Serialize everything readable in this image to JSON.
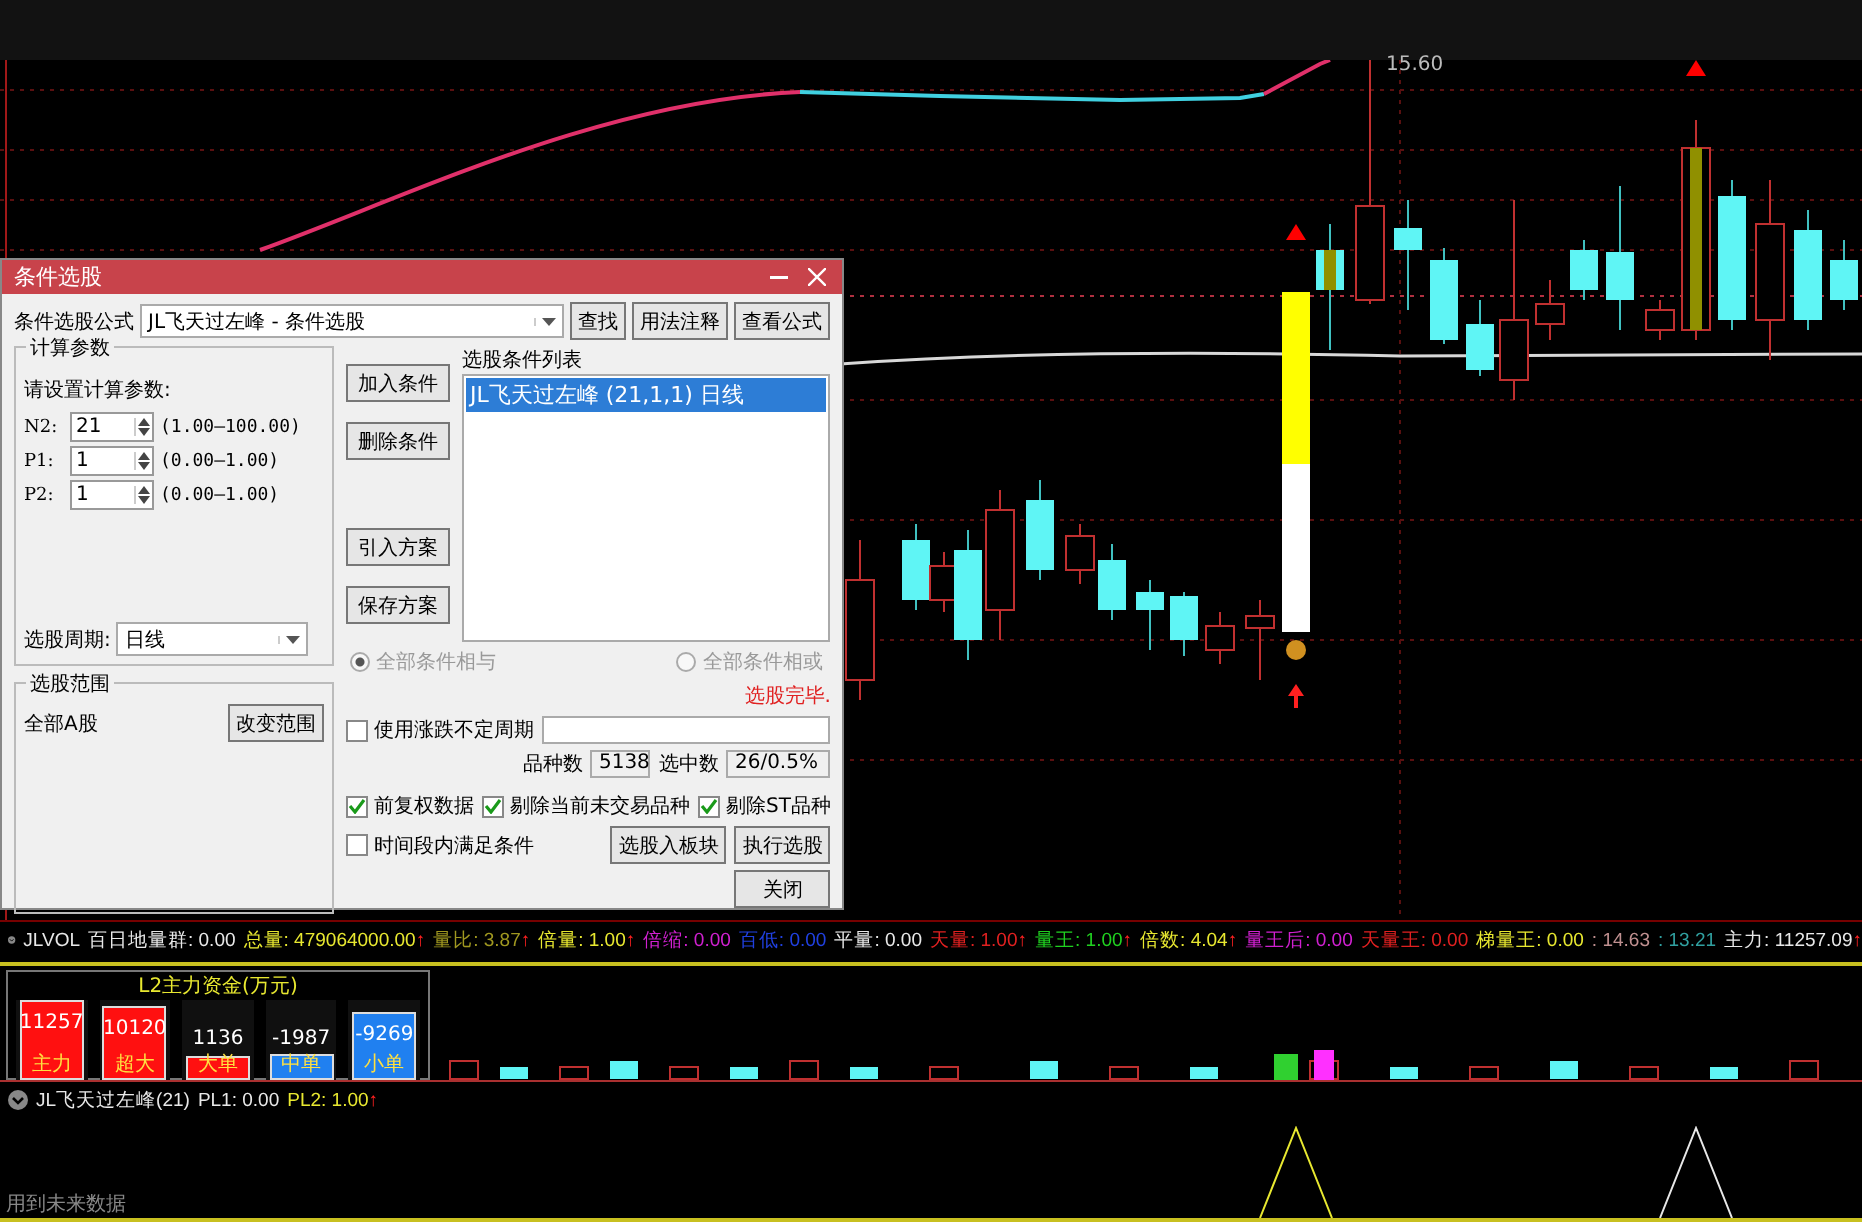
{
  "chart": {
    "price_label": "15.60"
  },
  "dialog": {
    "title": "条件选股",
    "formula_label": "条件选股公式",
    "formula_value": "JL飞天过左峰 - 条件选股",
    "top_buttons": [
      "查找",
      "用法注释",
      "查看公式"
    ],
    "params_group": "计算参数",
    "params_prompt": "请设置计算参数:",
    "params": [
      {
        "name": "N2:",
        "value": "21",
        "range": "(1.00—100.00)"
      },
      {
        "name": "P1:",
        "value": "1",
        "range": "(0.00—1.00)"
      },
      {
        "name": "P2:",
        "value": "1",
        "range": "(0.00—1.00)"
      }
    ],
    "period_label": "选股周期:",
    "period_value": "日线",
    "range_group": "选股范围",
    "range_value": "全部A股",
    "range_button": "改变范围",
    "side_buttons": [
      "加入条件",
      "删除条件",
      "引入方案",
      "保存方案"
    ],
    "list_title": "选股条件列表",
    "list_items": [
      {
        "text": "JL飞天过左峰 (21,1,1) 日线",
        "selected": true
      }
    ],
    "radios": [
      {
        "label": "全部条件相与",
        "selected": true,
        "disabled": true
      },
      {
        "label": "全部条件相或",
        "selected": false,
        "disabled": true
      }
    ],
    "status": "选股完毕.",
    "variable_period": {
      "label": "使用涨跌不定周期",
      "checked": false
    },
    "count_label": "品种数",
    "count_value": "5138",
    "picked_label": "选中数",
    "picked_value": "26/0.5%",
    "options": [
      {
        "label": "前复权数据",
        "checked": true
      },
      {
        "label": "剔除当前未交易品种",
        "checked": true
      },
      {
        "label": "剔除ST品种",
        "checked": true
      }
    ],
    "time_option": {
      "label": "时间段内满足条件",
      "checked": false
    },
    "bottom_buttons": [
      "选股入板块",
      "执行选股"
    ],
    "close_button": "关闭"
  },
  "indicator_bar": {
    "name": "JLVOL",
    "items": [
      {
        "text": "百日地量群: 0.00",
        "color": "#e8e8e8"
      },
      {
        "text": "总量: 479064000.00",
        "color": "#e8e830",
        "mark": "↑"
      },
      {
        "text": "量比: 3.87",
        "color": "#a09820",
        "mark": "↑"
      },
      {
        "text": "倍量: 1.00",
        "color": "#e8e830",
        "mark": "↑"
      },
      {
        "text": "倍缩: 0.00",
        "color": "#d020d0"
      },
      {
        "text": "百低: 0.00",
        "color": "#2040e0"
      },
      {
        "text": "平量: 0.00",
        "color": "#e8e8e8"
      },
      {
        "text": "天量: 1.00",
        "color": "#e02020",
        "mark": "↑"
      },
      {
        "text": "量王: 1.00",
        "color": "#20d020",
        "mark": "↑"
      },
      {
        "text": "倍数: 4.04",
        "color": "#e8e830",
        "mark": "↑"
      },
      {
        "text": "量王后: 0.00",
        "color": "#d020d0"
      },
      {
        "text": "天量王: 0.00",
        "color": "#e02020"
      },
      {
        "text": "梯量王: 0.00",
        "color": "#e8e830"
      },
      {
        "text": ": 14.63",
        "color": "#c09090"
      },
      {
        "text": ": 13.21",
        "color": "#30a0a0"
      },
      {
        "text": "主力: 11257.09",
        "color": "#e8e8e8",
        "mark": "↑"
      }
    ]
  },
  "funds_panel": {
    "title": "L2主力资金(万元)",
    "bars": [
      {
        "value": "11257",
        "label": "主力",
        "color": "#ff1010",
        "level": 1
      },
      {
        "value": "10120",
        "label": "超大",
        "color": "#ff1010",
        "level": 0.92
      },
      {
        "value": "1136",
        "label": "大单",
        "color": "#ff1010",
        "level": 0.3
      },
      {
        "value": "-1987",
        "label": "中单",
        "color": "#2080f0",
        "level": 0.32
      },
      {
        "value": "-9269",
        "label": "小单",
        "color": "#2080f0",
        "level": 0.85
      }
    ]
  },
  "indicator2": {
    "name": "JL飞天过左峰(21)",
    "items": [
      {
        "text": "PL1: 0.00",
        "color": "#e8e8e8"
      },
      {
        "text": "PL2: 1.00",
        "color": "#e8e830",
        "mark": "↑"
      }
    ]
  },
  "footer_note": "用到未来数据"
}
